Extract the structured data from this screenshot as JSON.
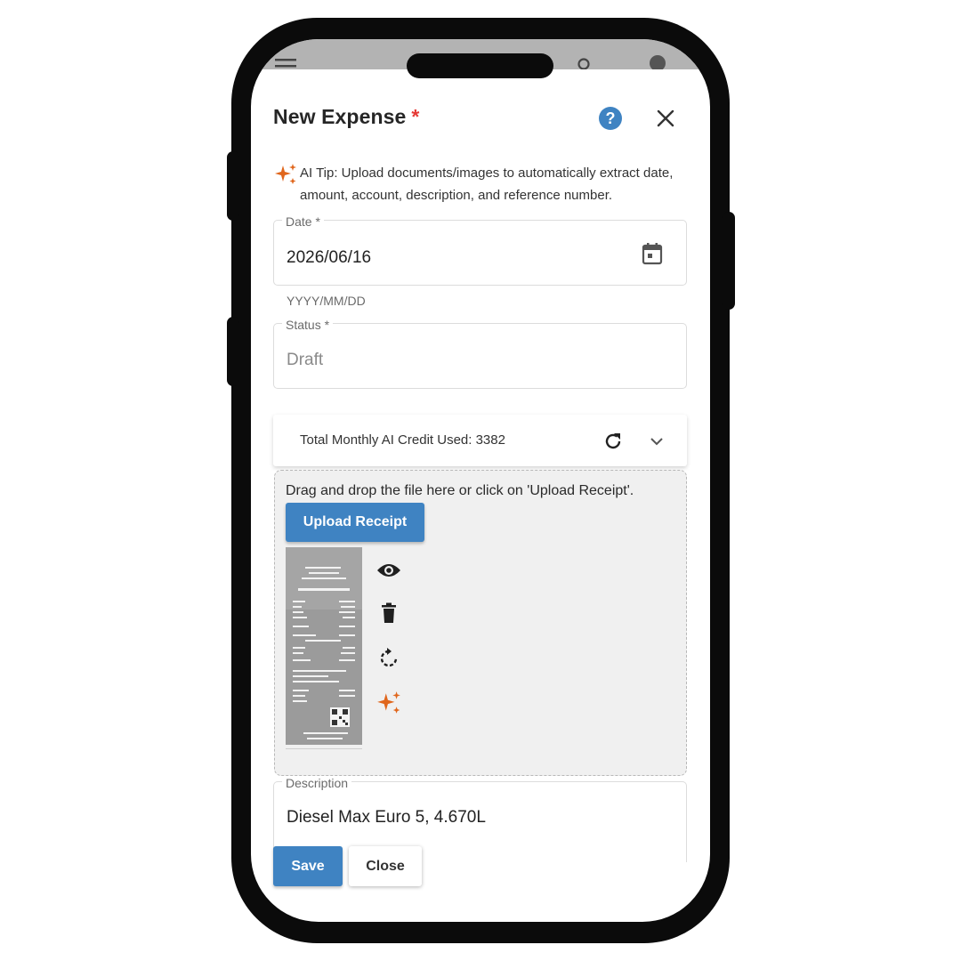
{
  "dialog": {
    "title": "New Expense",
    "required_marker": "*",
    "help_icon": "help-circle-icon",
    "close_icon": "close-icon"
  },
  "ai_tip": {
    "icon": "sparkles-icon",
    "text": "AI Tip: Upload documents/images to automatically extract date, amount, account, description, and reference number."
  },
  "date_field": {
    "label": "Date *",
    "value": "2026/06/16",
    "helper": "YYYY/MM/DD",
    "icon": "calendar-icon"
  },
  "status_field": {
    "label": "Status *",
    "value": "Draft"
  },
  "ai_credit": {
    "text": "Total Monthly AI Credit Used: 3382",
    "refresh_icon": "refresh-icon",
    "expand_icon": "chevron-down-icon"
  },
  "upload": {
    "drop_text": "Drag and drop the file here or click on 'Upload Receipt'.",
    "button_label": "Upload Receipt",
    "actions": [
      "eye-icon",
      "trash-icon",
      "rotate-icon",
      "sparkles-icon"
    ]
  },
  "description_field": {
    "label": "Description",
    "value": "Diesel Max Euro 5, 4.670L"
  },
  "footer": {
    "save_label": "Save",
    "close_label": "Close"
  },
  "colors": {
    "primary": "#3f83c2",
    "required": "#e53935",
    "ai_accent": "#e0661c"
  }
}
